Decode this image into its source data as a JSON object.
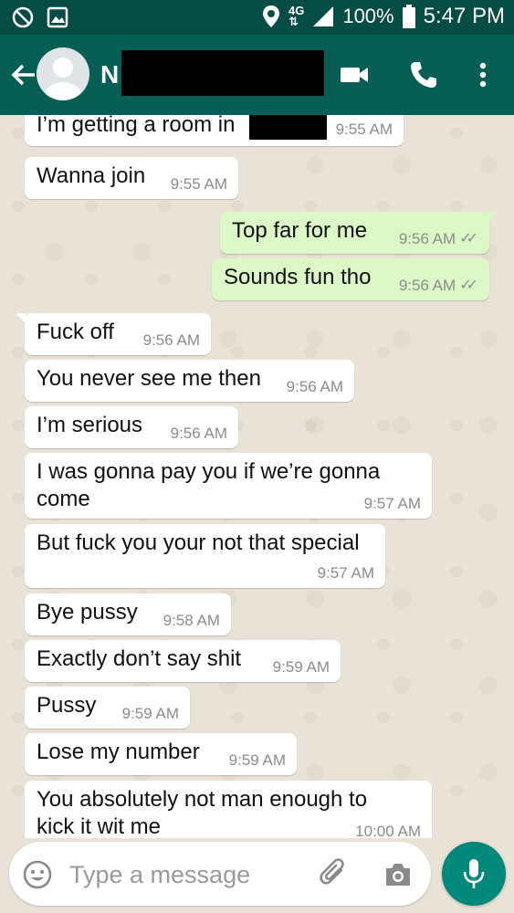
{
  "status_bar": {
    "network": "4G",
    "network_arrows": "⇅",
    "battery": "100%",
    "time": "5:47 PM"
  },
  "header": {
    "contact_initial": "N"
  },
  "messages": [
    {
      "dir": "in",
      "text": "I’m getting a room in",
      "time": "9:55 AM"
    },
    {
      "dir": "in",
      "text": "Wanna join",
      "time": "9:55 AM"
    },
    {
      "dir": "out",
      "text": "Top far for me",
      "time": "9:56 AM"
    },
    {
      "dir": "out",
      "text": "Sounds fun tho",
      "time": "9:56 AM"
    },
    {
      "dir": "in",
      "text": "Fuck off",
      "time": "9:56 AM"
    },
    {
      "dir": "in",
      "text": "You never see me then",
      "time": "9:56 AM"
    },
    {
      "dir": "in",
      "text": "I’m serious",
      "time": "9:56 AM"
    },
    {
      "dir": "in",
      "text": "I was gonna pay you if we’re gonna\ncome",
      "time": "9:57 AM"
    },
    {
      "dir": "in",
      "text": "But fuck you your not that special",
      "time": "9:57 AM"
    },
    {
      "dir": "in",
      "text": "Bye pussy",
      "time": "9:58 AM"
    },
    {
      "dir": "in",
      "text": "Exactly don’t say shit",
      "time": "9:59 AM"
    },
    {
      "dir": "in",
      "text": "Pussy",
      "time": "9:59 AM"
    },
    {
      "dir": "in",
      "text": "Lose my number",
      "time": "9:59 AM"
    },
    {
      "dir": "in",
      "text": "You absolutely not man enough to\nkick it wit me",
      "time": "10:00 AM"
    }
  ],
  "input": {
    "placeholder": "Type a message"
  },
  "icons": {
    "status_left": [
      "block-icon",
      "image-icon"
    ],
    "status_right": [
      "location-icon",
      "signal-icon",
      "battery-icon"
    ],
    "header": [
      "back-arrow-icon",
      "avatar-icon",
      "video-call-icon",
      "phone-icon",
      "more-vert-icon"
    ],
    "input": [
      "emoji-icon",
      "attach-icon",
      "camera-icon",
      "mic-icon"
    ]
  },
  "colors": {
    "status_bar": "#054d44",
    "app_bar": "#075e54",
    "incoming_bubble": "#ffffff",
    "outgoing_bubble": "#dcf8c6",
    "chat_background": "#e9e2d6",
    "mic_button": "#00897b"
  }
}
